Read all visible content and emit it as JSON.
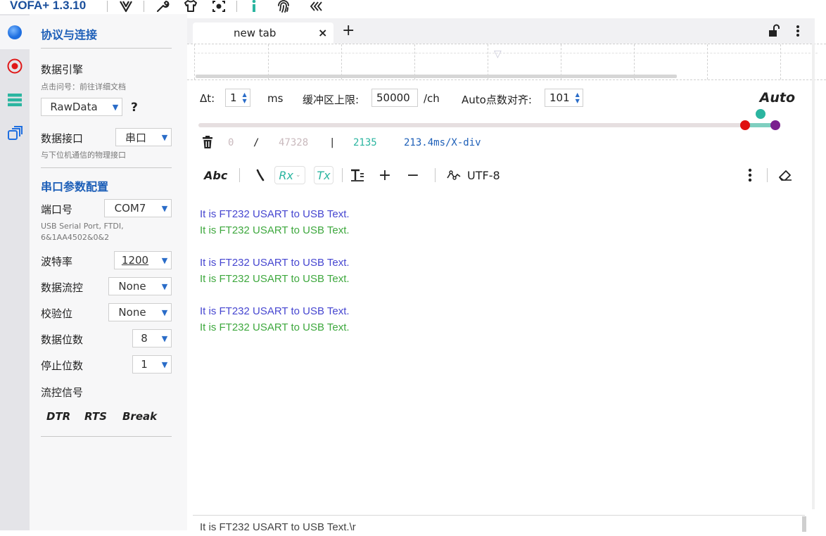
{
  "app": {
    "title": "VOFA+ 1.3.10",
    "toolbar_icons": [
      "vofa-logo-icon",
      "wrench-icon",
      "shirt-icon",
      "screenshot-icon",
      "info-icon",
      "fingerprint-icon",
      "collapse-left-icon"
    ]
  },
  "rail": {
    "items": [
      "connection-icon",
      "record-icon",
      "data-list-icon",
      "windows-icon"
    ]
  },
  "panel": {
    "section1_title": "协议与连接",
    "engine_label": "数据引擎",
    "engine_hint": "点击问号：前往详细文档",
    "engine_value": "RawData",
    "engine_help": "?",
    "interface_label": "数据接口",
    "interface_value": "串口",
    "interface_hint": "与下位机通信的物理接口",
    "section2_title": "串口参数配置",
    "port_label": "端口号",
    "port_value": "COM7",
    "port_hint_line1": "USB Serial Port, FTDI,",
    "port_hint_line2": "6&1AA4502&0&2",
    "baud_label": "波特率",
    "baud_value": "1200",
    "flow_label": "数据流控",
    "flow_value": "None",
    "parity_label": "校验位",
    "parity_value": "None",
    "databits_label": "数据位数",
    "databits_value": "8",
    "stopbits_label": "停止位数",
    "stopbits_value": "1",
    "flowsignal_label": "流控信号",
    "dtr": "DTR",
    "rts": "RTS",
    "break": "Break"
  },
  "tabs": {
    "active_label": "new tab",
    "close": "×",
    "add": "+"
  },
  "controls": {
    "dt_label": "Δt:",
    "dt_value": "1",
    "dt_unit": "ms",
    "buffer_label": "缓冲区上限:",
    "buffer_value": "50000",
    "buffer_unit": "/ch",
    "align_label": "Auto点数对齐:",
    "align_value": "101",
    "auto_label": "Auto"
  },
  "stats": {
    "a": "0",
    "slash": "/",
    "b": "47328",
    "bar": "|",
    "c": "2135",
    "d": "213.4ms/X-div"
  },
  "texttoolbar": {
    "abc": "Abc",
    "rx": "Rx",
    "tx": "Tx",
    "encoding": "UTF-8"
  },
  "received": {
    "lines": [
      {
        "text": "It is FT232 USART to USB Text.",
        "color": "#4646d0"
      },
      {
        "text": "It is FT232 USART to USB Text.",
        "color": "#3ea83e"
      },
      {
        "text": "It is FT232 USART to USB Text.",
        "color": "#4646d0"
      },
      {
        "text": "It is FT232 USART to USB Text.",
        "color": "#3ea83e"
      },
      {
        "text": "It is FT232 USART to USB Text.",
        "color": "#4646d0"
      },
      {
        "text": "It is FT232 USART to USB Text.",
        "color": "#3ea83e"
      }
    ]
  },
  "send": {
    "value": "It is FT232 USART to USB Text.\\r"
  },
  "colors": {
    "brand": "#1a4f9c",
    "accent": "#2a6cc8",
    "rx_text": "#4646d0",
    "tx_text": "#3ea83e",
    "teal": "#2bb5a0"
  }
}
